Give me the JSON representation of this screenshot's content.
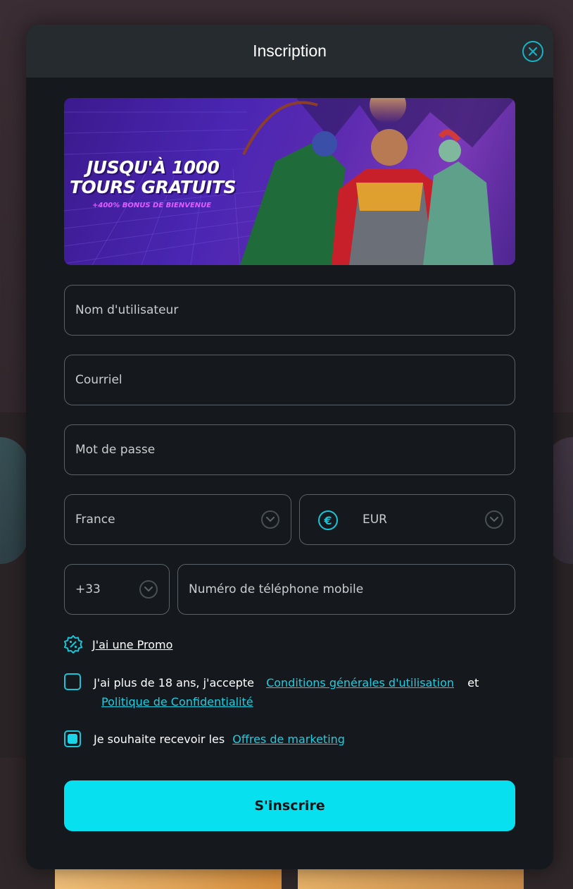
{
  "modal": {
    "title": "Inscription",
    "close_icon": "close-icon"
  },
  "banner": {
    "title_line1": "JUSQU'À 1000",
    "title_line2": "TOURS GRATUITS",
    "subtitle": "+400% BONUS DE BIENVENUE"
  },
  "form": {
    "username_placeholder": "Nom d'utilisateur",
    "email_placeholder": "Courriel",
    "password_placeholder": "Mot de passe",
    "country_value": "France",
    "currency_value": "EUR",
    "currency_icon": "euro-icon",
    "phone_code_value": "+33",
    "phone_placeholder": "Numéro de téléphone mobile"
  },
  "promo": {
    "label": "J'ai une Promo",
    "icon": "percent-badge-icon"
  },
  "terms": {
    "checked": false,
    "text_before": "J'ai plus de 18 ans, j'accepte",
    "link1": "Conditions générales d'utilisation",
    "text_and": "et",
    "link2": "Politique de Confidentialité"
  },
  "marketing": {
    "checked": true,
    "text_before": "Je souhaite recevoir les",
    "link": "Offres de marketing"
  },
  "submit_label": "S'inscrire",
  "colors": {
    "accent": "#06e0ef",
    "link": "#1fcde0",
    "modal_bg": "#15191d",
    "header_bg": "#252b2e"
  }
}
